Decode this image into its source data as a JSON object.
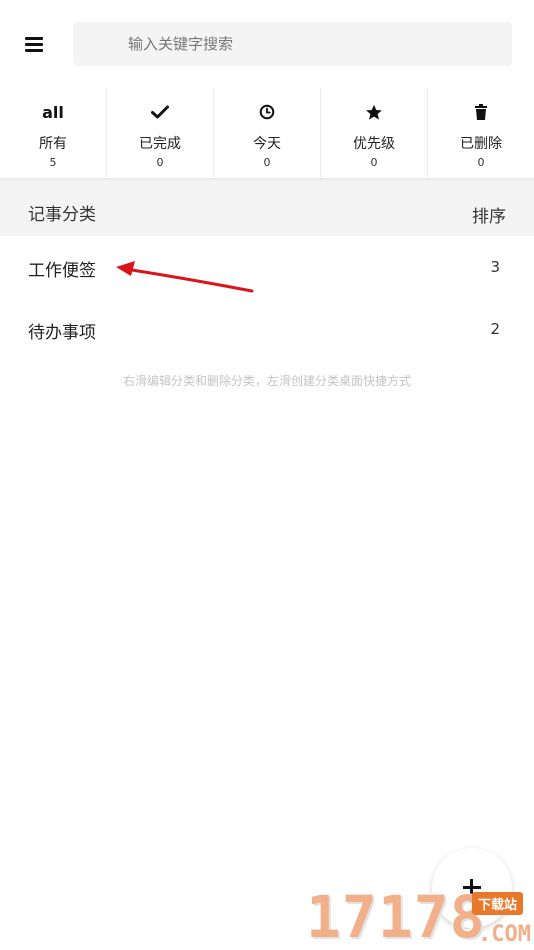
{
  "search": {
    "placeholder": "输入关键字搜索"
  },
  "filters": [
    {
      "icon": "all-text-icon",
      "icon_text": "all",
      "label": "所有",
      "count": "5"
    },
    {
      "icon": "check-icon",
      "label": "已完成",
      "count": "0"
    },
    {
      "icon": "clock-icon",
      "label": "今天",
      "count": "0"
    },
    {
      "icon": "star-icon",
      "label": "优先级",
      "count": "0"
    },
    {
      "icon": "trash-icon",
      "label": "已删除",
      "count": "0"
    }
  ],
  "section": {
    "title": "记事分类",
    "sort_label": "排序"
  },
  "categories": [
    {
      "name": "工作便签",
      "count": "3"
    },
    {
      "name": "待办事项",
      "count": "2"
    }
  ],
  "hint": "右滑编辑分类和删除分类，左滑创建分类桌面快捷方式",
  "watermark": {
    "number": "17178",
    "tag": "下载站",
    "suffix": ".COM"
  },
  "colors": {
    "annotation_arrow": "#d9151b",
    "watermark_orange": "#e8792c"
  }
}
